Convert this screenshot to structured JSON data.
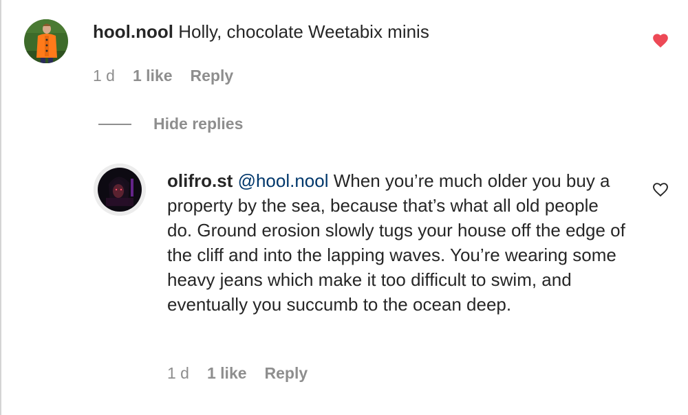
{
  "comment": {
    "username": "hool.nool",
    "text": "Holly, chocolate Weetabix minis",
    "time": "1 d",
    "likes": "1 like",
    "reply_label": "Reply",
    "liked": true
  },
  "replies_toggle": {
    "label": "Hide replies"
  },
  "reply": {
    "username": "olifro.st",
    "mention": "@hool.nool",
    "text": "When you’re much older you buy a property by the sea, because that’s what all old people do. Ground erosion slowly tugs your house off the edge of the cliff and into the lapping waves. You’re wearing some heavy jeans which make it too difficult to swim, and eventually you succumb to the ocean deep.",
    "time": "1 d",
    "likes": "1 like",
    "reply_label": "Reply",
    "liked": false
  },
  "colors": {
    "liked_heart": "#ed4956",
    "secondary_text": "#8e8e8e",
    "mention": "#00376b"
  }
}
